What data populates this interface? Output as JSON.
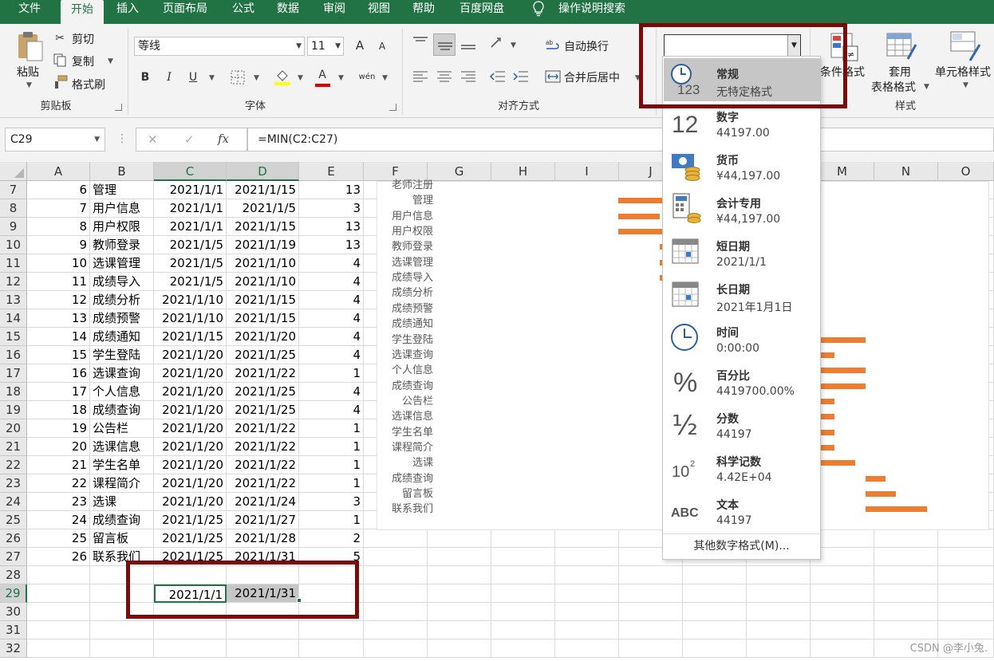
{
  "menu": [
    "文件",
    "开始",
    "插入",
    "页面布局",
    "公式",
    "数据",
    "审阅",
    "视图",
    "帮助",
    "百度网盘",
    "操作说明搜索"
  ],
  "ribbon": {
    "clipboard": {
      "paste": "粘贴",
      "cut": "剪切",
      "copy": "复制",
      "format_painter": "格式刷",
      "group": "剪贴板"
    },
    "font": {
      "name": "等线",
      "size": "11",
      "grow": "A",
      "shrink": "A",
      "bold": "B",
      "italic": "I",
      "underline": "U",
      "color_letter": "A",
      "phonetic": "wén",
      "group": "字体"
    },
    "alignment": {
      "wrap": "自动换行",
      "merge": "合并后居中",
      "group": "对齐方式"
    },
    "number": {
      "format_value": ""
    },
    "styles": {
      "cond_format": "条件格式",
      "table_format_1": "套用",
      "table_format_2": "表格格式",
      "cell_styles": "单元格样式",
      "group": "样式"
    }
  },
  "formula_bar": {
    "name_box": "C29",
    "cancel": "✕",
    "enter": "✓",
    "fx": "fx",
    "formula": "=MIN(C2:C27)"
  },
  "columns": [
    "A",
    "B",
    "C",
    "D",
    "E",
    "F",
    "G",
    "H",
    "I",
    "J",
    "K",
    "L",
    "M",
    "N",
    "O"
  ],
  "row_numbers": [
    "7",
    "8",
    "9",
    "10",
    "11",
    "12",
    "13",
    "14",
    "15",
    "16",
    "17",
    "18",
    "19",
    "20",
    "21",
    "22",
    "23",
    "24",
    "25",
    "26",
    "27",
    "28",
    "29",
    "30",
    "31",
    "32"
  ],
  "table": [
    [
      "6",
      "管理",
      "2021/1/1",
      "2021/1/15",
      "13"
    ],
    [
      "7",
      "用户信息",
      "2021/1/1",
      "2021/1/5",
      "3"
    ],
    [
      "8",
      "用户权限",
      "2021/1/1",
      "2021/1/15",
      "13"
    ],
    [
      "9",
      "教师登录",
      "2021/1/5",
      "2021/1/19",
      "13"
    ],
    [
      "10",
      "选课管理",
      "2021/1/5",
      "2021/1/10",
      "4"
    ],
    [
      "11",
      "成绩导入",
      "2021/1/5",
      "2021/1/10",
      "4"
    ],
    [
      "12",
      "成绩分析",
      "2021/1/10",
      "2021/1/15",
      "4"
    ],
    [
      "13",
      "成绩预警",
      "2021/1/10",
      "2021/1/15",
      "4"
    ],
    [
      "14",
      "成绩通知",
      "2021/1/15",
      "2021/1/20",
      "4"
    ],
    [
      "15",
      "学生登陆",
      "2021/1/20",
      "2021/1/25",
      "4"
    ],
    [
      "16",
      "选课查询",
      "2021/1/20",
      "2021/1/22",
      "1"
    ],
    [
      "17",
      "个人信息",
      "2021/1/20",
      "2021/1/25",
      "4"
    ],
    [
      "18",
      "成绩查询",
      "2021/1/20",
      "2021/1/25",
      "4"
    ],
    [
      "19",
      "公告栏",
      "2021/1/20",
      "2021/1/22",
      "1"
    ],
    [
      "20",
      "选课信息",
      "2021/1/20",
      "2021/1/22",
      "1"
    ],
    [
      "21",
      "学生名单",
      "2021/1/20",
      "2021/1/22",
      "1"
    ],
    [
      "22",
      "课程简介",
      "2021/1/20",
      "2021/1/22",
      "1"
    ],
    [
      "23",
      "选课",
      "2021/1/20",
      "2021/1/24",
      "3"
    ],
    [
      "24",
      "成绩查询",
      "2021/1/25",
      "2021/1/27",
      "1"
    ],
    [
      "25",
      "留言板",
      "2021/1/25",
      "2021/1/28",
      "2"
    ],
    [
      "26",
      "联系我们",
      "2021/1/25",
      "2021/1/31",
      "5"
    ]
  ],
  "row29": {
    "c": "2021/1/1",
    "d": "2021/1/31"
  },
  "chart_labels": [
    "老师注册",
    "管理",
    "用户信息",
    "用户权限",
    "教师登录",
    "选课管理",
    "成绩导入",
    "成绩分析",
    "成绩预警",
    "成绩通知",
    "学生登陆",
    "选课查询",
    "个人信息",
    "成绩查询",
    "公告栏",
    "选课信息",
    "学生名单",
    "课程简介",
    "选课",
    "成绩查询",
    "留言板",
    "联系我们"
  ],
  "number_format_menu": {
    "items": [
      {
        "icon": "clock-123-icon",
        "name": "常规",
        "sample": "无特定格式"
      },
      {
        "icon": "number-12-icon",
        "name": "数字",
        "sample": "44197.00"
      },
      {
        "icon": "currency-icon",
        "name": "货币",
        "sample": "¥44,197.00"
      },
      {
        "icon": "calculator-icon",
        "name": "会计专用",
        "sample": " ¥44,197.00"
      },
      {
        "icon": "calendar-small-icon",
        "name": "短日期",
        "sample": "2021/1/1"
      },
      {
        "icon": "calendar-large-icon",
        "name": "长日期",
        "sample": "2021年1月1日"
      },
      {
        "icon": "clock-icon",
        "name": "时间",
        "sample": "0:00:00"
      },
      {
        "icon": "percent-icon",
        "name": "百分比",
        "sample": "4419700.00%"
      },
      {
        "icon": "fraction-icon",
        "name": "分数",
        "sample": "44197"
      },
      {
        "icon": "scientific-icon",
        "name": "科学记数",
        "sample": "4.42E+04"
      },
      {
        "icon": "text-abc-icon",
        "name": "文本",
        "sample": "44197"
      }
    ],
    "more": "其他数字格式(M)..."
  },
  "icon_glyphs": {
    "n12": "12",
    "n123": "123",
    "pct": "%",
    "half": "½",
    "ten": "10",
    "sup2": "2",
    "abc": "ABC"
  },
  "watermark": "CSDN @李小兔.",
  "colors": {
    "accent": "#217346",
    "bar": "#ed7d31",
    "highlight": "#7b0a0a"
  }
}
